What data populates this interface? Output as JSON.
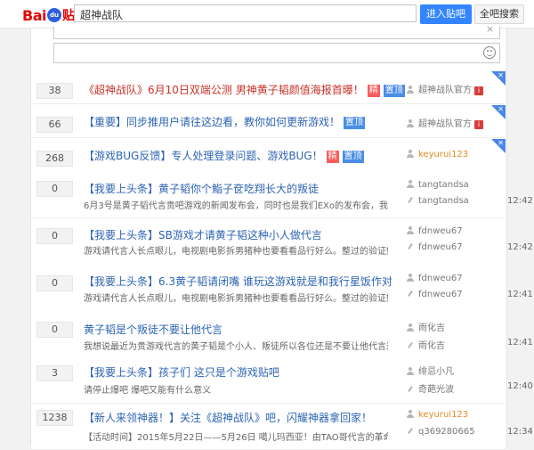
{
  "header": {
    "logo_text_bai": "Bai",
    "logo_text_du": "du",
    "logo_text_tieba": "贴吧",
    "search_value": "超神战队",
    "enter_button": "进入贴吧",
    "all_search_button": "全吧搜索"
  },
  "editor": {
    "close_icon": "×"
  },
  "threads": [
    {
      "count": "38",
      "title": "《超神战队》6月10日双端公测 男神黄子韬颜值海报首曝！",
      "title_color": "red",
      "tags": [
        "精",
        "置顶"
      ],
      "abstract": "",
      "user": "超神战队官方",
      "user_icon": "person",
      "user_vip": "i",
      "time": "",
      "corner": true
    },
    {
      "count": "66",
      "title": "【重要】同步推用户请往这边看，教你如何更新游戏！",
      "title_color": "blue",
      "tags": [
        "置顶"
      ],
      "abstract": "",
      "user": "超神战队官方",
      "user_icon": "person",
      "user_vip": "i",
      "time": "",
      "corner": true
    },
    {
      "count": "268",
      "title": "【游戏BUG反馈】专人处理登录问题、游戏BUG！",
      "title_color": "blue",
      "tags": [
        "精",
        "置顶"
      ],
      "abstract": "",
      "user": "keyurui123",
      "user_icon": "person",
      "user_vip": "",
      "time": "",
      "corner": true,
      "user_orange": true
    },
    {
      "count": "0",
      "title": "【我要上头条】黄子韬你个鮨子奁吃翔长大的叛徒",
      "title_color": "blue",
      "tags": [],
      "abstract": "6月3号是黄子韬代言贵吧游戏的新闻发布会，同时也是我们EXo的发布会，我就不…",
      "user": "tangtandsa",
      "user_icon": "person",
      "user2": "tangtandsa",
      "time": "12:42"
    },
    {
      "count": "0",
      "title": "【我要上头条】SB游戏才请黄子韬这种小人做代言",
      "title_color": "blue",
      "tags": [],
      "abstract": "游戏请代言人长点眼儿，电视剧电影拆男猪种也要看看品行好么。整过的验证好意…",
      "user": "fdnweu67",
      "user_icon": "person",
      "user2": "fdnweu67",
      "time": "12:42"
    },
    {
      "count": "0",
      "title": "【我要上头条】6.3黄子韬请闭嘴 谁玩这游戏就是和我行星饭作对",
      "title_color": "blue",
      "tags": [],
      "abstract": "游戏请代言人长点眼儿，电视剧电影拆男猪种也要看看品行好么。整过的验证好意…",
      "user": "fdnweu67",
      "user_icon": "person",
      "user2": "fdnweu67",
      "time": "12:41"
    },
    {
      "count": "0",
      "title": "黄子韬是个叛徒不要让他代言",
      "title_color": "blue",
      "tags": [],
      "abstract": "我想说最近为贵游戏代言的黄子韬是个小人、叛徒所以各位还是不要让他代言这游…",
      "user": "雨化吉",
      "user_icon": "person",
      "user2": "雨化吉",
      "time": "12:41"
    },
    {
      "count": "3",
      "title": "【我要上头条】孩子们 这只是个游戏贴吧",
      "title_color": "blue",
      "tags": [],
      "abstract": "请停止爆吧 爆吧又能有什么意义",
      "user": "绯忌小凡",
      "user_icon": "person",
      "user2": "奇葩光波",
      "time": "12:40"
    },
    {
      "count": "1238",
      "title": "【新人来领神器！】关注《超神战队》吧，闪耀神器拿回家！",
      "title_color": "blue",
      "tags": [],
      "abstract": "【活动时间】2015年5月22日——5月26日 噶儿玛西亚！由TAO哥代言的革命性动…",
      "user": "keyurui123",
      "user_icon": "person",
      "user2": "q369280665",
      "time": "12:34",
      "user_orange": true
    }
  ],
  "colors": {
    "accent_blue": "#3385ff",
    "link_blue": "#2d64b3",
    "red_title": "#c8322a",
    "tag_red": "#f75c5c",
    "tag_blue": "#4b8ee6"
  }
}
